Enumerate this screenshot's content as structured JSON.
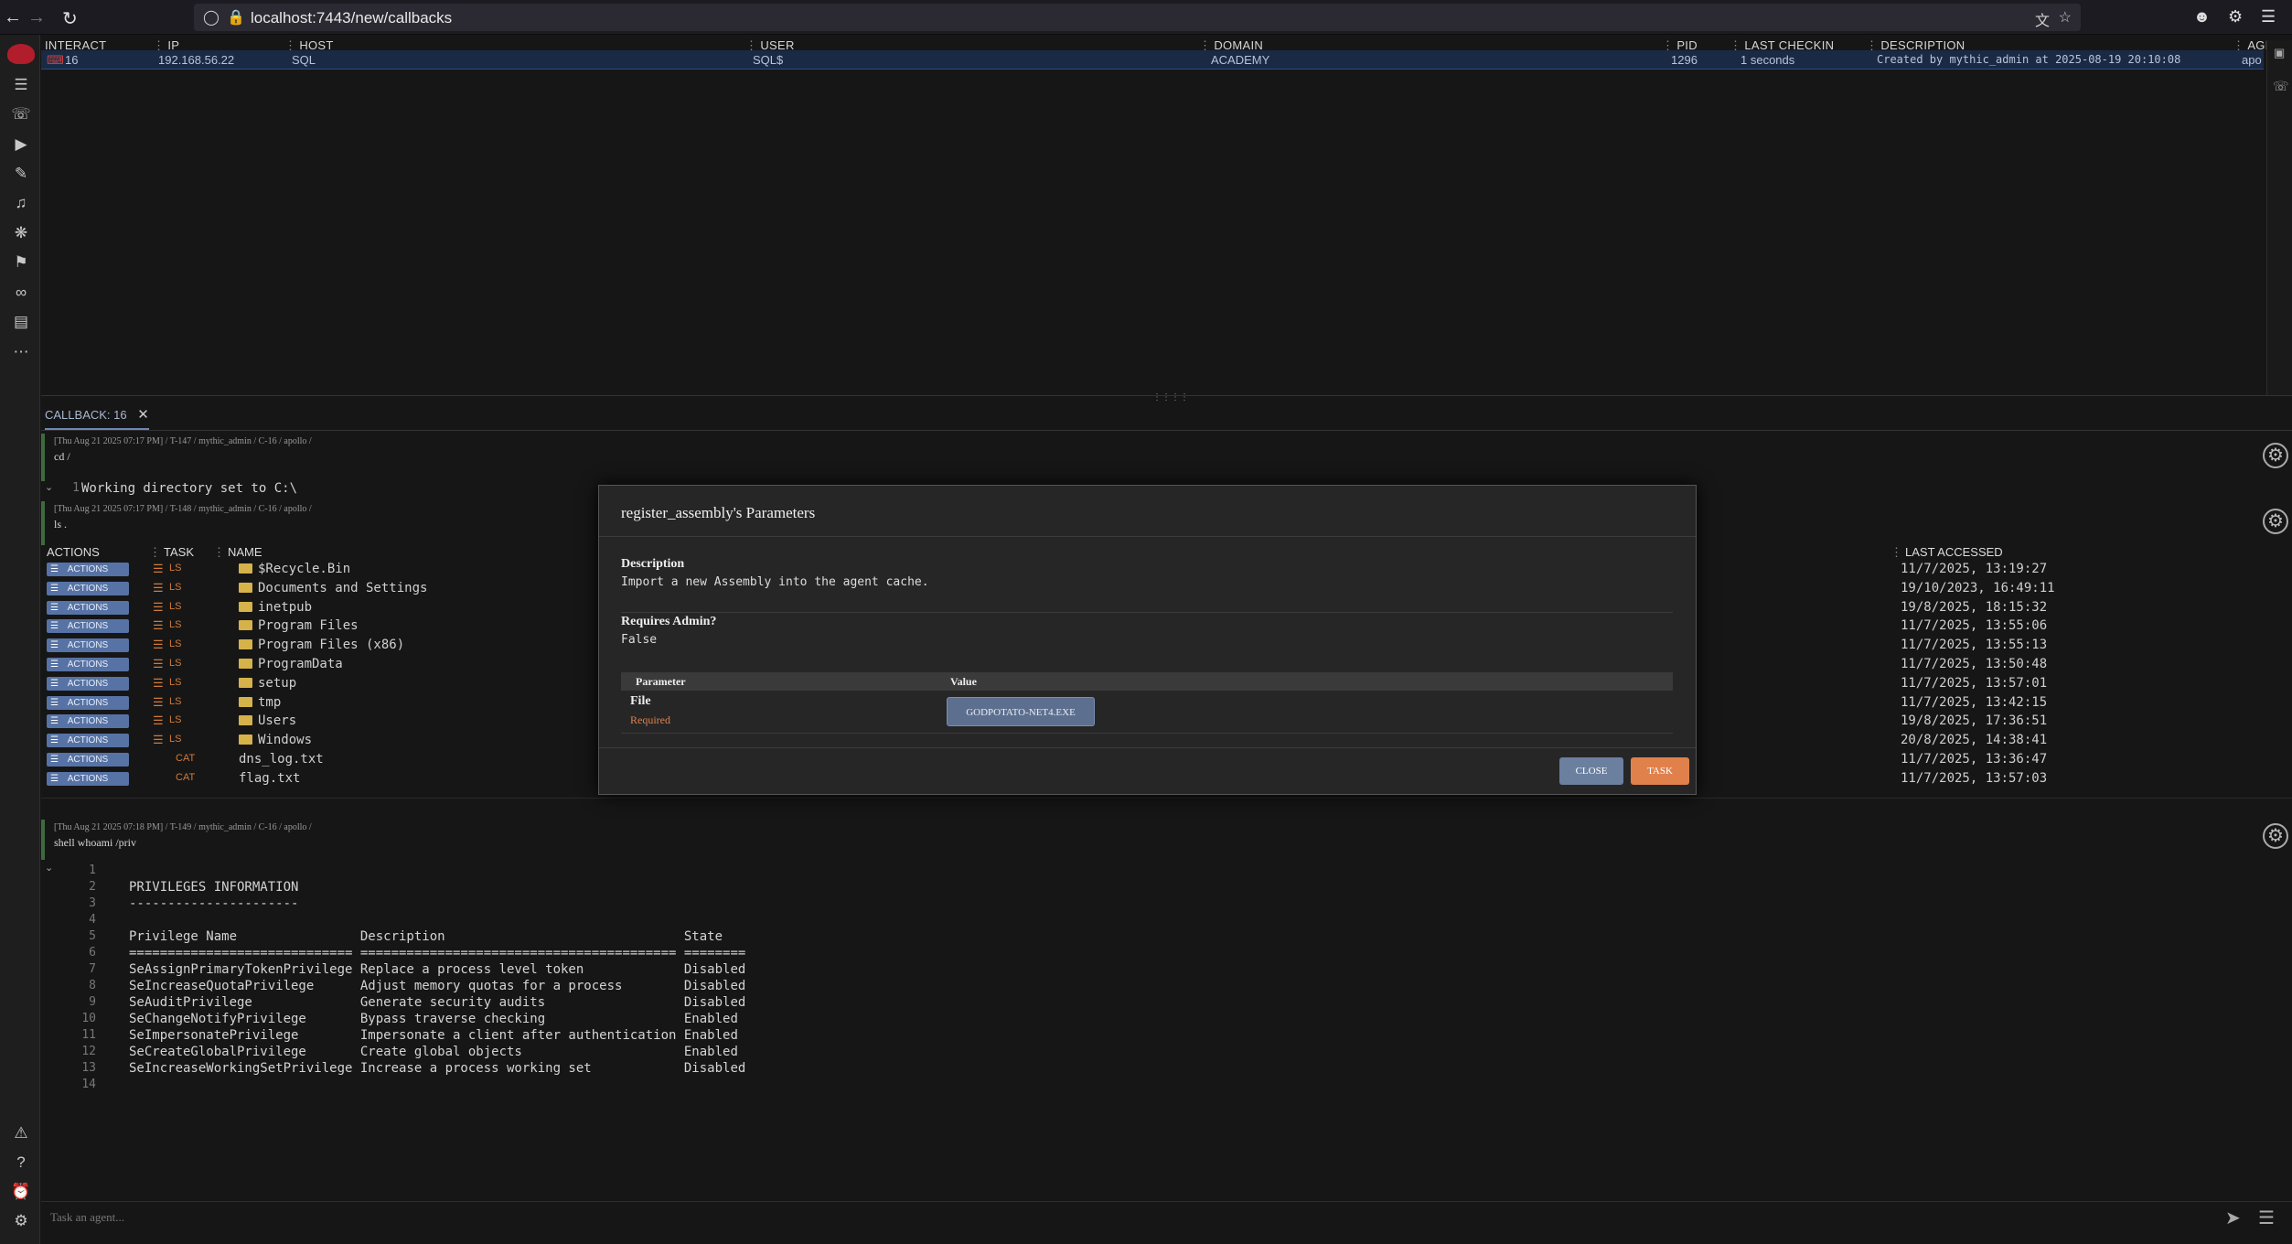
{
  "browser": {
    "url": "localhost:7443/new/callbacks"
  },
  "callbacks_table": {
    "headers": [
      "INTERACT",
      "IP",
      "HOST",
      "USER",
      "DOMAIN",
      "PID",
      "LAST CHECKIN",
      "DESCRIPTION",
      "AGE"
    ],
    "row": {
      "interact": "16",
      "ip": "192.168.56.22",
      "host": "SQL",
      "user": "SQL$",
      "domain": "ACADEMY",
      "pid": "1296",
      "last_checkin": "1 seconds",
      "description": "Created by mythic_admin at 2025-08-19 20:10:08",
      "agent": "apo"
    }
  },
  "tab": {
    "label": "CALLBACK: 16"
  },
  "tasks": [
    {
      "meta": "[Thu Aug 21 2025 07:17 PM] / T-147 / mythic_admin / C-16 / apollo /",
      "command": "cd /",
      "output_line_no": "1",
      "output": "Working directory set to C:\\"
    },
    {
      "meta": "[Thu Aug 21 2025 07:17 PM] / T-148 / mythic_admin / C-16 / apollo /",
      "command": "ls ."
    },
    {
      "meta": "[Thu Aug 21 2025 07:18 PM] / T-149 / mythic_admin / C-16 / apollo /",
      "command": "shell whoami /priv"
    }
  ],
  "ls_table": {
    "headers": [
      "ACTIONS",
      "TASK",
      "NAME",
      "LAST ACCESSED"
    ],
    "action_label": "ACTIONS",
    "rows": [
      {
        "task": "LS",
        "name": "$Recycle.Bin",
        "last": "11/7/2025, 13:19:27"
      },
      {
        "task": "LS",
        "name": "Documents and Settings",
        "last": "19/10/2023, 16:49:11"
      },
      {
        "task": "LS",
        "name": "inetpub",
        "last": "19/8/2025, 18:15:32"
      },
      {
        "task": "LS",
        "name": "Program Files",
        "last": "11/7/2025, 13:55:06"
      },
      {
        "task": "LS",
        "name": "Program Files (x86)",
        "last": "11/7/2025, 13:55:13"
      },
      {
        "task": "LS",
        "name": "ProgramData",
        "last": "11/7/2025, 13:50:48"
      },
      {
        "task": "LS",
        "name": "setup",
        "last": "11/7/2025, 13:57:01"
      },
      {
        "task": "LS",
        "name": "tmp",
        "last": "11/7/2025, 13:42:15"
      },
      {
        "task": "LS",
        "name": "Users",
        "last": "19/8/2025, 17:36:51"
      },
      {
        "task": "LS",
        "name": "Windows",
        "last": "20/8/2025, 14:38:41"
      },
      {
        "task": "CAT",
        "name": "dns_log.txt",
        "last": "11/7/2025, 13:36:47"
      },
      {
        "task": "CAT",
        "name": "flag.txt",
        "last": "11/7/2025, 13:57:03"
      }
    ]
  },
  "priv_output": [
    {
      "n": "1",
      "t": ""
    },
    {
      "n": "2",
      "t": "PRIVILEGES INFORMATION"
    },
    {
      "n": "3",
      "t": "----------------------"
    },
    {
      "n": "4",
      "t": ""
    },
    {
      "n": "5",
      "t": "Privilege Name                Description                               State"
    },
    {
      "n": "6",
      "t": "============================= ========================================= ========"
    },
    {
      "n": "7",
      "t": "SeAssignPrimaryTokenPrivilege Replace a process level token             Disabled"
    },
    {
      "n": "8",
      "t": "SeIncreaseQuotaPrivilege      Adjust memory quotas for a process        Disabled"
    },
    {
      "n": "9",
      "t": "SeAuditPrivilege              Generate security audits                  Disabled"
    },
    {
      "n": "10",
      "t": "SeChangeNotifyPrivilege       Bypass traverse checking                  Enabled"
    },
    {
      "n": "11",
      "t": "SeImpersonatePrivilege        Impersonate a client after authentication Enabled"
    },
    {
      "n": "12",
      "t": "SeCreateGlobalPrivilege       Create global objects                     Enabled"
    },
    {
      "n": "13",
      "t": "SeIncreaseWorkingSetPrivilege Increase a process working set            Disabled"
    },
    {
      "n": "14",
      "t": ""
    }
  ],
  "modal": {
    "title": "register_assembly's Parameters",
    "description_label": "Description",
    "description": "Import a new Assembly into the agent cache.",
    "admin_label": "Requires Admin?",
    "admin_value": "False",
    "param_header": "Parameter",
    "value_header": "Value",
    "param_name": "File",
    "param_required": "Required",
    "file_button": "GODPOTATO-NET4.EXE",
    "close": "CLOSE",
    "task": "TASK"
  },
  "input": {
    "placeholder": "Task an agent..."
  },
  "colors": {
    "accent": "#5773a5",
    "task_button": "#e0814b",
    "required": "#e0814b"
  }
}
